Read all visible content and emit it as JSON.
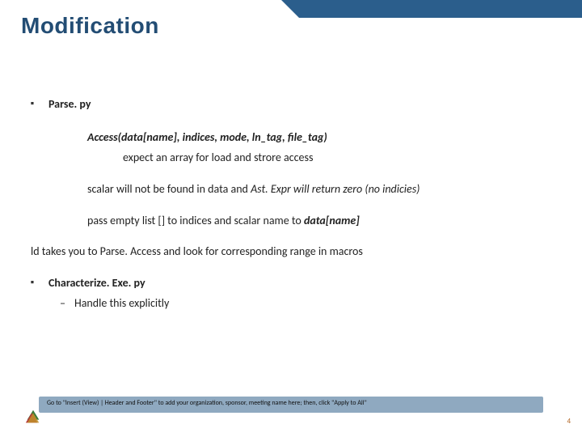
{
  "title": "Modification",
  "bullets": {
    "b1": "Parse. py",
    "access_sig": "Access(data[name], indices, mode, ln_tag, file_tag)",
    "expect": "expect an array for load and strore access",
    "scalar_pre": "scalar will not be found in data and ",
    "scalar_mid": "Ast. Expr will return zero (no indicies)",
    "pass_pre": "pass empty list [] to indices and scalar name to ",
    "pass_tail": "data[name]",
    "ld": "ld takes you to Parse. Access and look for corresponding range in macros",
    "b2": "Characterize. Exe. py",
    "b2_sub": "Handle this explicitly"
  },
  "footer": "Go to \"Insert (View) | Header and Footer\" to add your organization, sponsor, meeting name here; then, click \"Apply to All\"",
  "page": "4"
}
